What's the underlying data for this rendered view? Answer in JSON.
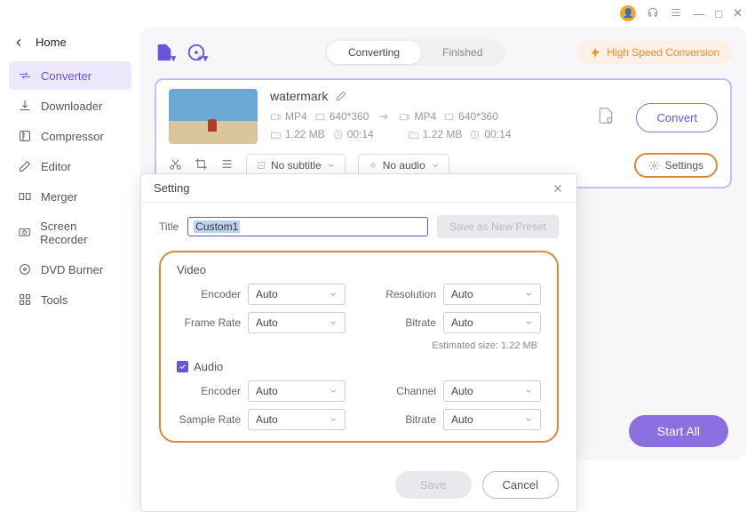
{
  "titlebar": {
    "min": "—",
    "max": "□",
    "close": "✕"
  },
  "home_label": "Home",
  "nav": [
    {
      "label": "Converter",
      "active": true
    },
    {
      "label": "Downloader"
    },
    {
      "label": "Compressor"
    },
    {
      "label": "Editor"
    },
    {
      "label": "Merger"
    },
    {
      "label": "Screen Recorder"
    },
    {
      "label": "DVD Burner"
    },
    {
      "label": "Tools"
    }
  ],
  "tabs": {
    "converting": "Converting",
    "finished": "Finished"
  },
  "hsc": "High Speed Conversion",
  "file": {
    "title": "watermark",
    "src": {
      "format": "MP4",
      "res": "640*360",
      "size": "1.22 MB",
      "dur": "00:14"
    },
    "dst": {
      "format": "MP4",
      "res": "640*360",
      "size": "1.22 MB",
      "dur": "00:14"
    },
    "subtitle": "No subtitle",
    "audio": "No audio",
    "settings_label": "Settings",
    "convert": "Convert"
  },
  "start_all": "Start All",
  "modal": {
    "heading": "Setting",
    "title_label": "Title",
    "title_value": "Custom1",
    "save_preset": "Save as New Preset",
    "video_label": "Video",
    "audio_label": "Audio",
    "fields": {
      "encoder": "Encoder",
      "auto": "Auto",
      "resolution": "Resolution",
      "framerate": "Frame Rate",
      "bitrate": "Bitrate",
      "samplerate": "Sample Rate",
      "channel": "Channel"
    },
    "estimated": "Estimated size: 1.22 MB",
    "save": "Save",
    "cancel": "Cancel"
  }
}
